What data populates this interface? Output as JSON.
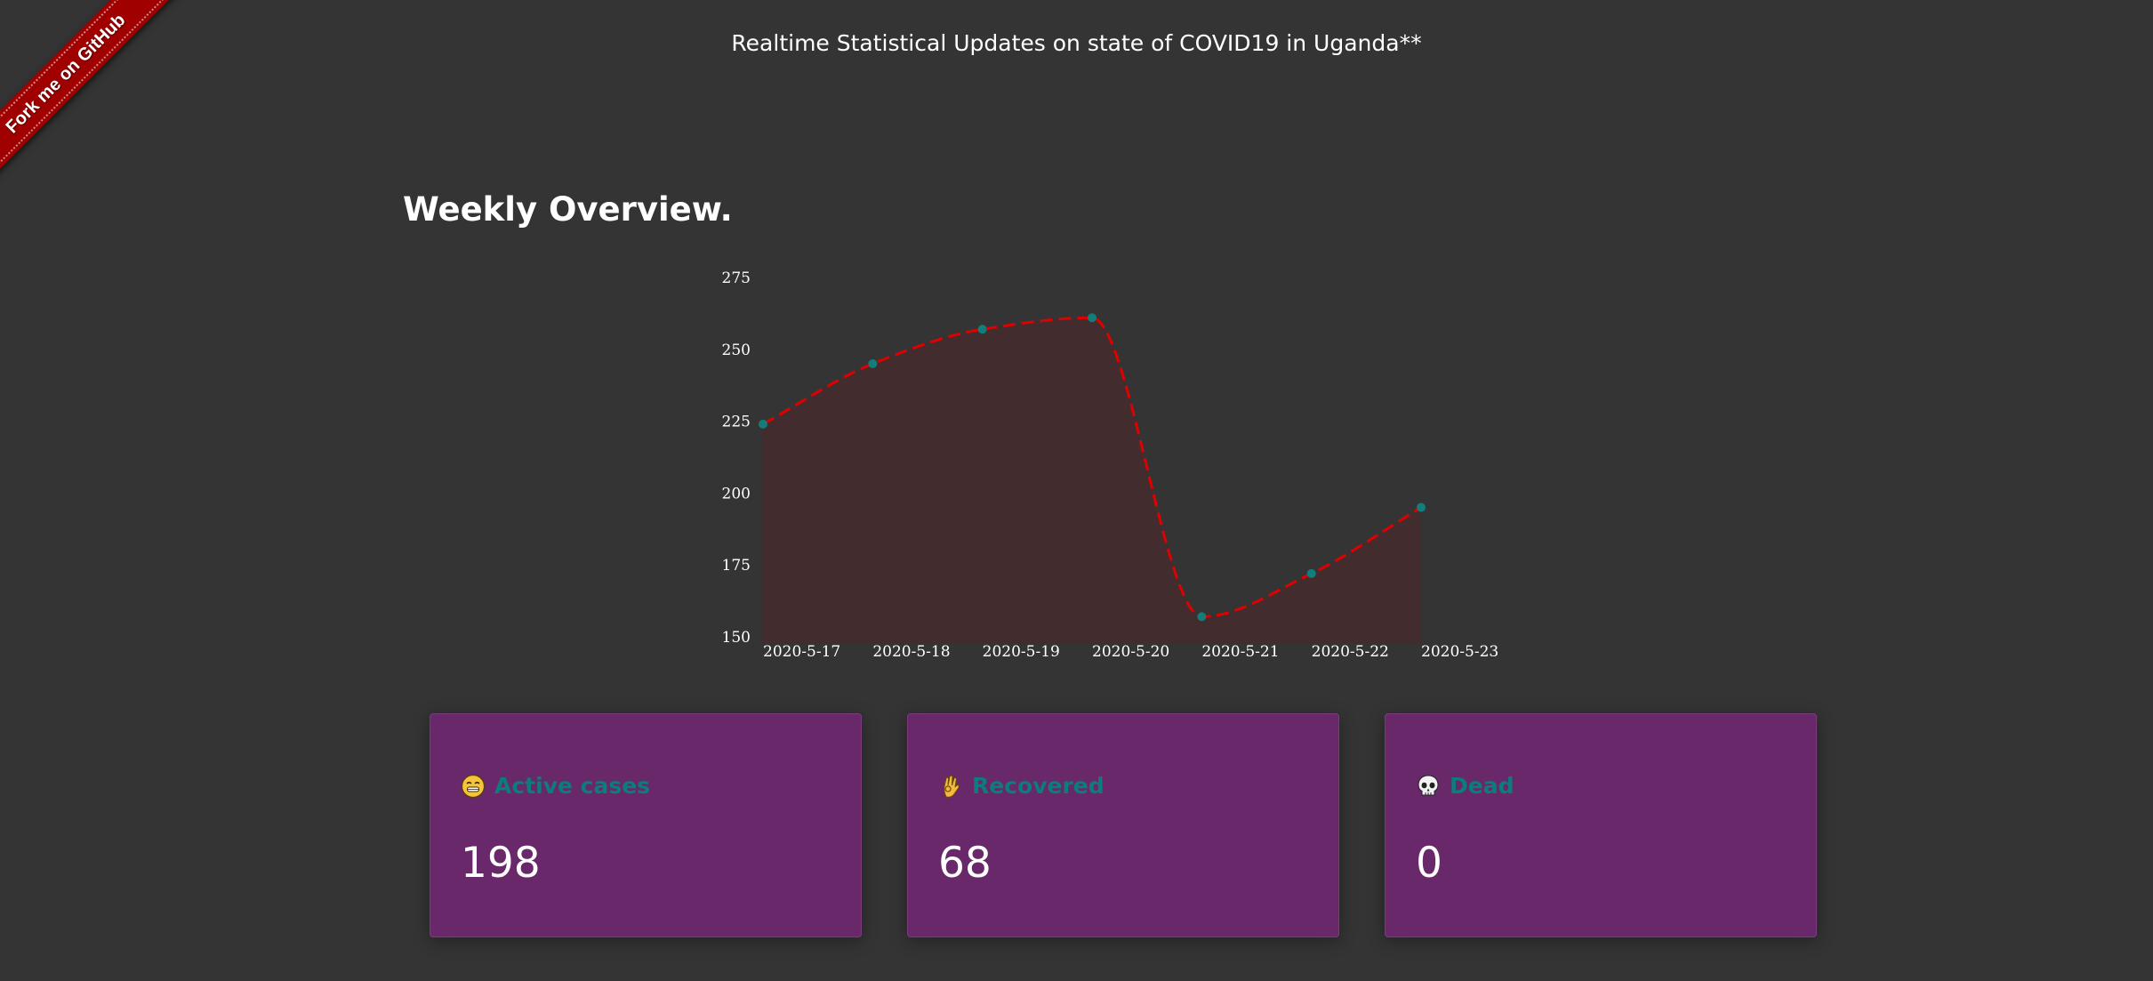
{
  "ribbon": {
    "label": "Fork me on GitHub"
  },
  "header": {
    "title": "Realtime Statistical Updates on state of COVID19 in Uganda**"
  },
  "overview": {
    "heading": "Weekly Overview."
  },
  "colors": {
    "background": "#343434",
    "line": "#e00000",
    "area_fill": "#432c2d",
    "points": "#127d7a",
    "card": "#68286a",
    "card_label": "#0c7c7c",
    "ribbon": "#a00000"
  },
  "chart_data": {
    "type": "area",
    "title": "",
    "xlabel": "",
    "ylabel": "",
    "categories": [
      "2020-5-17",
      "2020-5-18",
      "2020-5-19",
      "2020-5-20",
      "2020-5-21",
      "2020-5-22",
      "2020-5-23"
    ],
    "series": [
      {
        "values": [
          224,
          245,
          257,
          261,
          157,
          172,
          195
        ]
      }
    ],
    "ylim": [
      150,
      275
    ],
    "yticks": [
      150,
      175,
      200,
      225,
      250,
      275
    ],
    "line_style": "dashed",
    "curve": "smooth",
    "grid": false,
    "legend": "none"
  },
  "cards": [
    {
      "icon": "grimace-face-icon",
      "label": "Active cases",
      "value": "198"
    },
    {
      "icon": "ok-hand-icon",
      "label": "Recovered",
      "value": "68"
    },
    {
      "icon": "skull-icon",
      "label": "Dead",
      "value": "0"
    }
  ]
}
